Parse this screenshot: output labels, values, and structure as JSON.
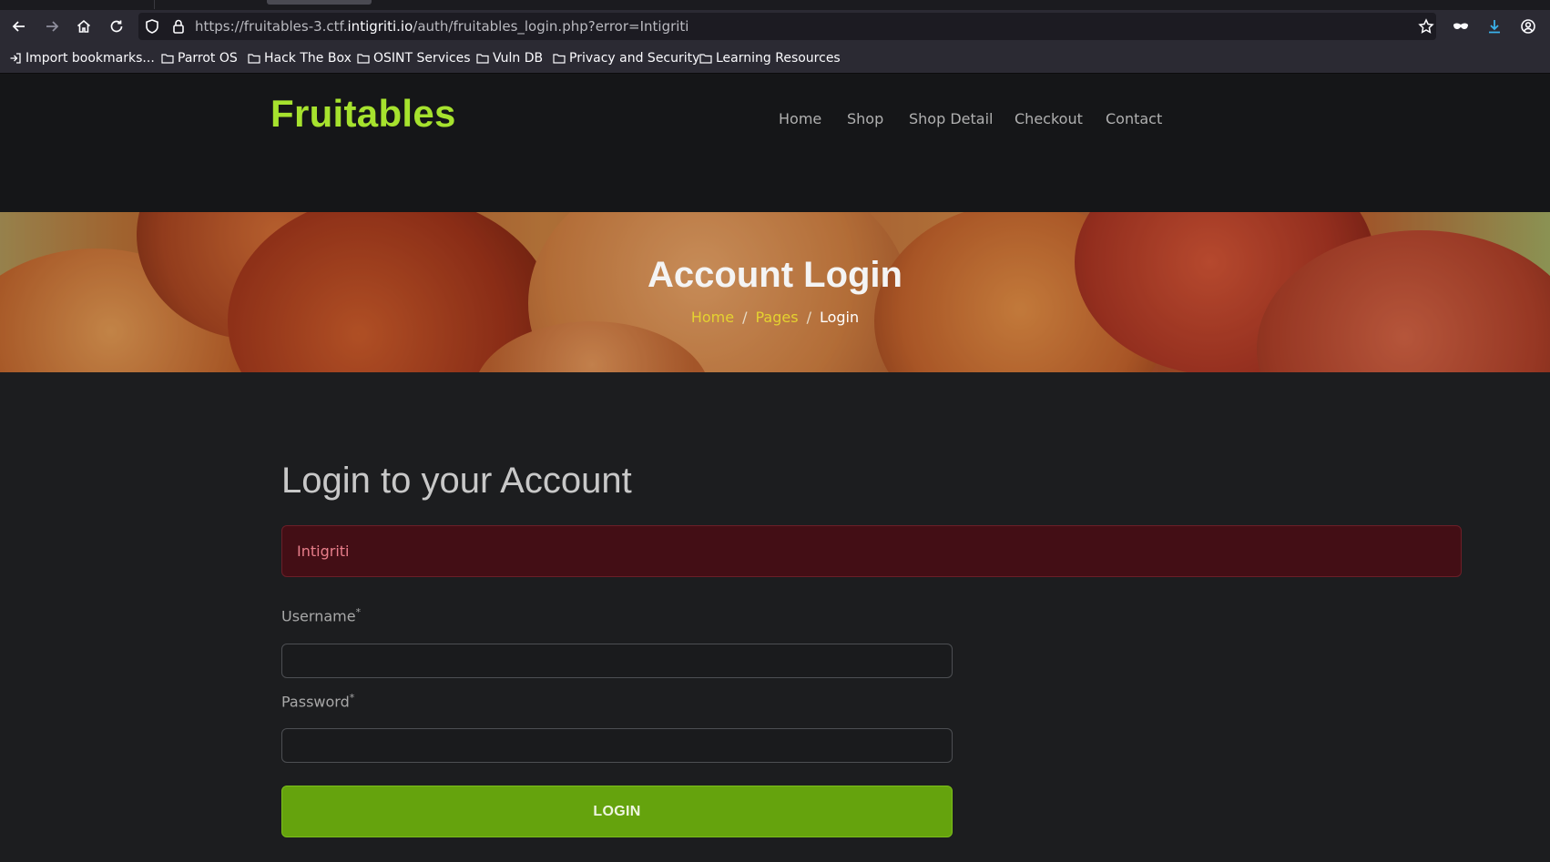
{
  "browser": {
    "url_prefix": "https://fruitables-3.ctf.",
    "url_host": "intigriti.io",
    "url_path": "/auth/fruitables_login.php?error=Intigriti",
    "icons": [
      "back-icon",
      "forward-icon",
      "home-icon",
      "reload-icon",
      "shield-icon",
      "lock-icon",
      "star-icon",
      "mask-icon",
      "download-icon",
      "account-icon"
    ],
    "bookmarks": [
      {
        "label": "Import bookmarks...",
        "icon": "import-icon"
      },
      {
        "label": "Parrot OS",
        "icon": "folder-icon"
      },
      {
        "label": "Hack The Box",
        "icon": "folder-icon"
      },
      {
        "label": "OSINT Services",
        "icon": "folder-icon"
      },
      {
        "label": "Vuln DB",
        "icon": "folder-icon"
      },
      {
        "label": "Privacy and Security",
        "icon": "folder-icon"
      },
      {
        "label": "Learning Resources",
        "icon": "folder-icon"
      }
    ]
  },
  "site": {
    "logo": "Fruitables",
    "menu": [
      "Home",
      "Shop",
      "Shop Detail",
      "Checkout",
      "Contact"
    ]
  },
  "hero": {
    "title": "Account Login",
    "breadcrumb": {
      "home": "Home",
      "pages": "Pages",
      "separator": "/",
      "current": "Login"
    }
  },
  "login": {
    "title": "Login to your Account",
    "error": "Intigriti",
    "username_label": "Username",
    "username_value": "",
    "password_label": "Password",
    "password_value": "",
    "required_mark": "*",
    "submit": "LOGIN"
  },
  "colors": {
    "brand": "#a6e22e",
    "button": "#65a30d",
    "breadcrumb_link": "#e5d230",
    "alert_bg": "#430e15",
    "alert_text": "#e87e8a"
  }
}
